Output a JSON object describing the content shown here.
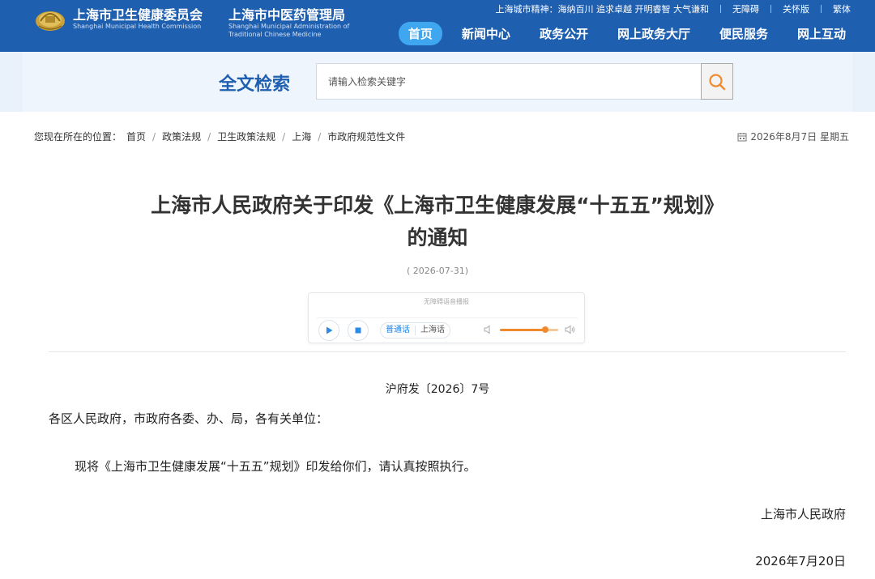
{
  "header": {
    "org_name_1": "上海市卫生健康委员会",
    "org_name_1_en": "Shanghai Municipal Health Commission",
    "org_name_2": "上海市中医药管理局",
    "org_name_2_en": "Shanghai Municipal Administration of Traditional Chinese Medicine",
    "city_spirit": "上海城市精神：海纳百川 追求卓越 开明睿智 大气谦和",
    "top_links": [
      "无障碍",
      "关怀版",
      "繁体"
    ],
    "nav": [
      {
        "label": "首页",
        "active": true
      },
      {
        "label": "新闻中心",
        "active": false
      },
      {
        "label": "政务公开",
        "active": false
      },
      {
        "label": "网上政务大厅",
        "active": false
      },
      {
        "label": "便民服务",
        "active": false
      },
      {
        "label": "网上互动",
        "active": false
      }
    ],
    "colors": {
      "header_bg": "#1f5fb0",
      "nav_active": "#3fa6f0"
    }
  },
  "search": {
    "title": "全文检索",
    "placeholder": "请输入检索关键字",
    "button_icon": "search-icon"
  },
  "breadcrumb": {
    "prefix": "您现在所在的位置：",
    "items": [
      "首页",
      "政策法规",
      "卫生政策法规",
      "上海",
      "市政府规范性文件"
    ]
  },
  "today": "2026年8月7日 星期五",
  "article": {
    "title_line1": "上海市人民政府关于印发《上海市卫生健康发展“十五五”规划》",
    "title_line2": "的通知",
    "pub_date": "( 2026-07-31)",
    "doc_number": "沪府发〔2026〕7号",
    "recipients": "各区人民政府，市政府各委、办、局，各有关单位：",
    "body": "现将《上海市卫生健康发展“十五五”规划》印发给你们，请认真按照执行。",
    "signature": "上海市人民政府",
    "sign_date": "2026年7月20日"
  },
  "player": {
    "label": "无障碍语音播报",
    "lang_options": [
      "普通话",
      "上海话"
    ],
    "selected_lang": "普通话",
    "volume": 0.78,
    "accent": "#f08a2c"
  }
}
